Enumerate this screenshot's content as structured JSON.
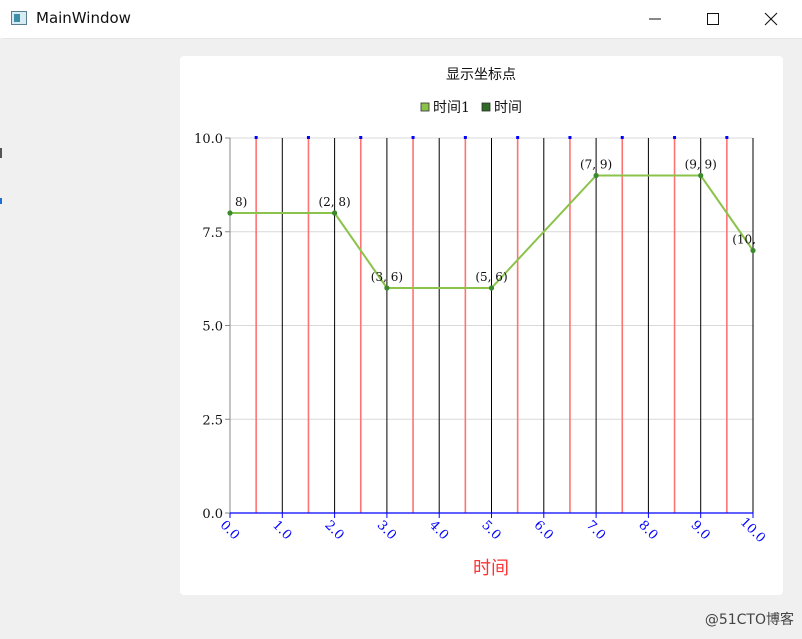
{
  "window": {
    "title": "MainWindow",
    "icons": [
      "app-window-icon",
      "minimize-icon",
      "maximize-icon",
      "close-icon"
    ]
  },
  "watermark": "@51CTO博客",
  "colors": {
    "series_line": "#8bc34a",
    "point": "#3c8a2e",
    "x_axis_label": "#ff3333",
    "x_axis_ticks": "#0000ff",
    "red_grid": "#ff7373",
    "black_grid": "#000000",
    "h_grid": "#d9d9d9"
  },
  "chart_data": {
    "type": "line",
    "title": "显示坐标点",
    "legend": [
      {
        "label": "时间1",
        "color": "#8bc34a"
      },
      {
        "label": "时间",
        "color": "#2e6b25"
      }
    ],
    "legend_position": "top",
    "xlabel": "时间",
    "ylabel": "",
    "xlim": [
      0,
      10
    ],
    "ylim": [
      0,
      10
    ],
    "x_ticks": [
      "0.0",
      "1.0",
      "2.0",
      "3.0",
      "4.0",
      "5.0",
      "6.0",
      "7.0",
      "8.0",
      "9.0",
      "10.0"
    ],
    "y_ticks": [
      "0.0",
      "2.5",
      "5.0",
      "7.5",
      "10.0"
    ],
    "grid": true,
    "series": [
      {
        "name": "时间1",
        "x": [
          0,
          2,
          3,
          5,
          7,
          9,
          10
        ],
        "y": [
          8,
          8,
          6,
          6,
          9,
          9,
          7
        ]
      }
    ],
    "point_labels": [
      "8)",
      "(2, 8)",
      "(3, 6)",
      "(5, 6)",
      "(7, 9)",
      "(9, 9)",
      "(10,"
    ],
    "red_grid_x": [
      0.5,
      1.5,
      2.5,
      3.5,
      4.5,
      5.5,
      6.5,
      7.5,
      8.5,
      9.5
    ],
    "black_grid_x": [
      1,
      2,
      3,
      4,
      5,
      6,
      7,
      8,
      9,
      10
    ]
  }
}
